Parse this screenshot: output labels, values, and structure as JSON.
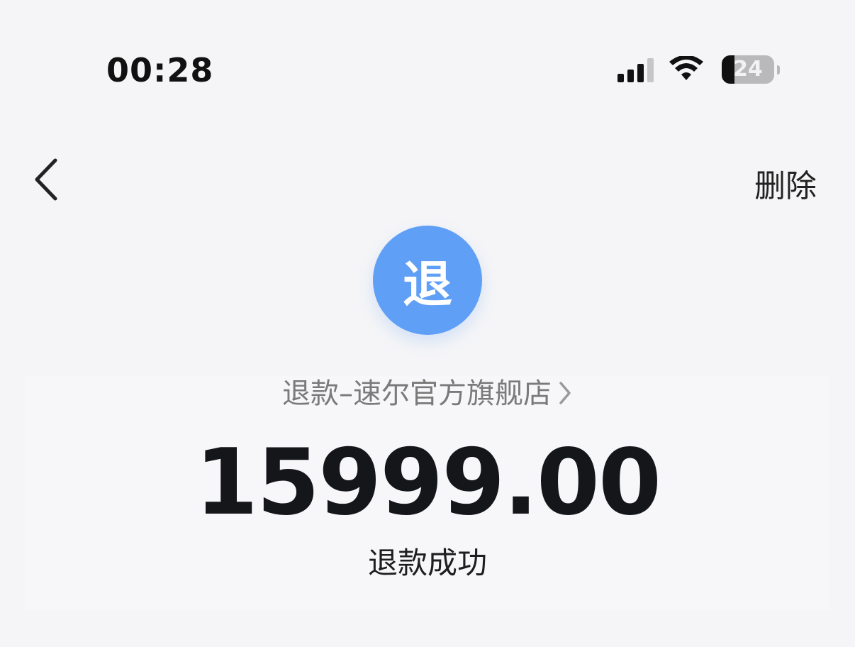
{
  "status_bar": {
    "time": "00:28",
    "signal": {
      "level": 3,
      "max": 4
    },
    "battery": {
      "level": 24,
      "label": "24"
    },
    "icons": [
      "signal-icon",
      "wifi-icon",
      "battery-icon"
    ]
  },
  "nav": {
    "back_icon": "chevron-left-icon",
    "delete_label": "删除"
  },
  "transaction": {
    "avatar_char": "退",
    "avatar_color": "#5f9ff5",
    "merchant_label": "退款–速尔官方旗舰店",
    "merchant_chevron_icon": "chevron-right-icon",
    "amount": "15999.00",
    "status": "退款成功"
  }
}
